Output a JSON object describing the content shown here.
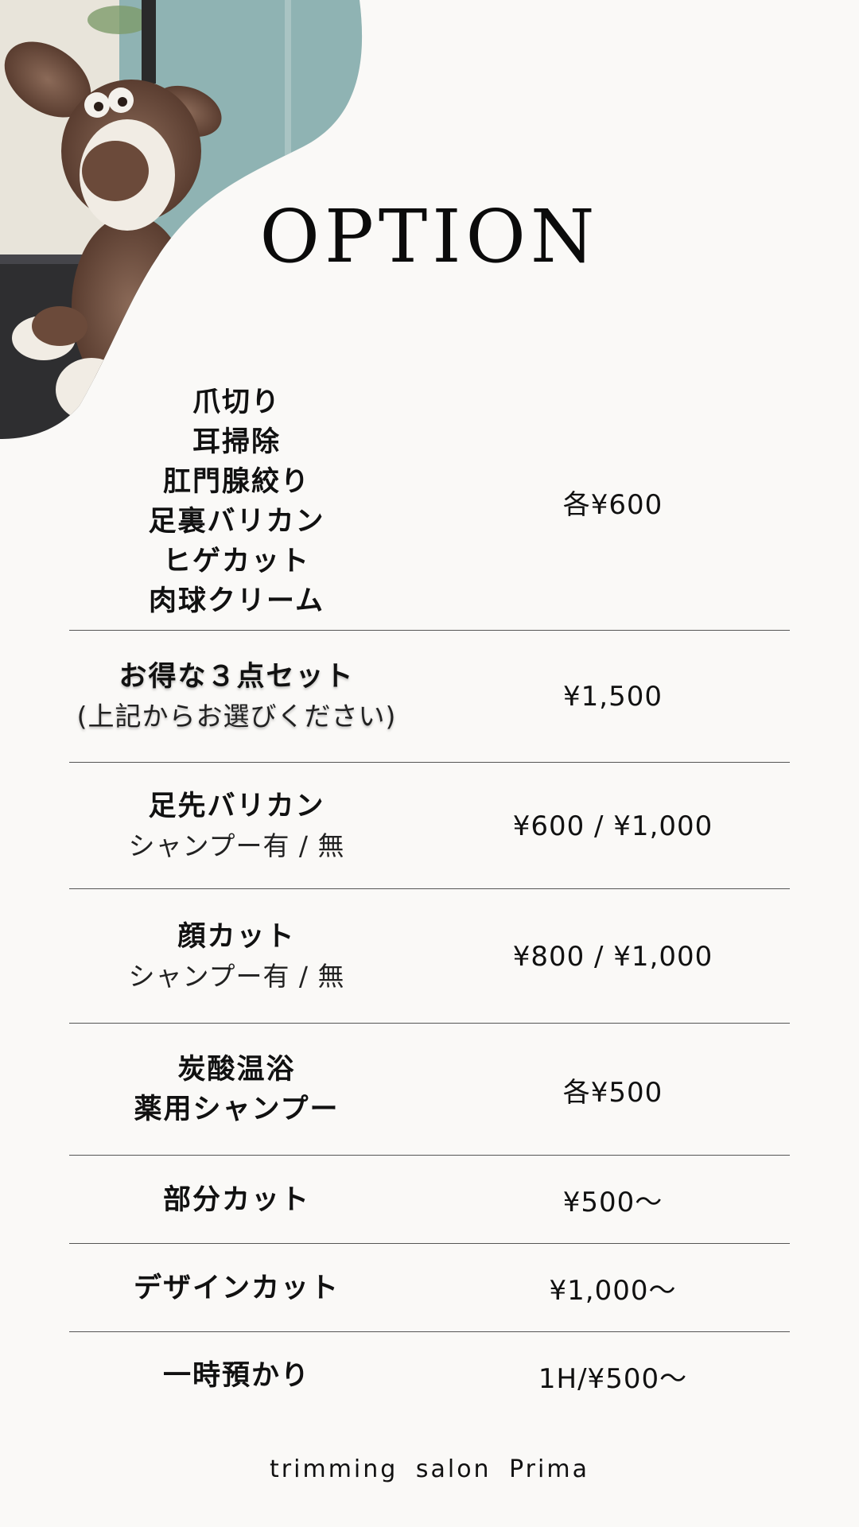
{
  "title": "OPTION",
  "items": [
    {
      "lines": [
        "爪切り",
        "耳掃除",
        "肛門腺絞り",
        "足裏バリカン",
        "ヒゲカット",
        "肉球クリーム"
      ],
      "price": "各¥600"
    },
    {
      "main": "お得な３点セット",
      "sub": "(上記からお選びください)",
      "price": "¥1,500"
    },
    {
      "main": "足先バリカン",
      "sub": "シャンプー有 / 無",
      "price": "¥600 / ¥1,000"
    },
    {
      "main": "顔カット",
      "sub": "シャンプー有 / 無",
      "price": "¥800 / ¥1,000"
    },
    {
      "lines": [
        "炭酸温浴",
        "薬用シャンプー"
      ],
      "price": "各¥500"
    },
    {
      "main": "部分カット",
      "price": "¥500〜"
    },
    {
      "main": "デザインカット",
      "price": "¥1,000〜"
    },
    {
      "main": "一時預かり",
      "price": "1H/¥500〜"
    }
  ],
  "footer": "trimming salon Prima",
  "colors": {
    "background": "#faf9f7",
    "text": "#111111",
    "divider": "#555555"
  }
}
